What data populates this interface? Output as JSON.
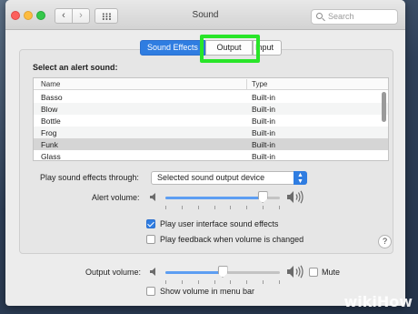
{
  "window": {
    "title": "Sound"
  },
  "search": {
    "placeholder": "Search"
  },
  "tabs": [
    {
      "label": "Sound Effects",
      "selected": true
    },
    {
      "label": "Output",
      "selected": false,
      "highlighted": true
    },
    {
      "label": "Input",
      "selected": false
    }
  ],
  "alert_section": {
    "heading": "Select an alert sound:",
    "columns": [
      "Name",
      "Type"
    ],
    "rows": [
      {
        "name": "Basso",
        "type": "Built-in"
      },
      {
        "name": "Blow",
        "type": "Built-in"
      },
      {
        "name": "Bottle",
        "type": "Built-in"
      },
      {
        "name": "Frog",
        "type": "Built-in"
      },
      {
        "name": "Funk",
        "type": "Built-in",
        "selected": true
      },
      {
        "name": "Glass",
        "type": "Built-in"
      }
    ]
  },
  "play_through": {
    "label": "Play sound effects through:",
    "selected": "Selected sound output device"
  },
  "alert_volume": {
    "label": "Alert volume:",
    "level": 0.85
  },
  "options": {
    "ui_sounds": {
      "label": "Play user interface sound effects",
      "checked": true
    },
    "feedback": {
      "label": "Play feedback when volume is changed",
      "checked": false
    }
  },
  "help": {
    "label": "?"
  },
  "output_volume": {
    "label": "Output volume:",
    "level": 0.5
  },
  "mute": {
    "label": "Mute",
    "checked": false
  },
  "menu_bar": {
    "label": "Show volume in menu bar",
    "checked": false
  },
  "watermark": {
    "wiki": "wiki",
    "how": "How"
  },
  "icons": [
    "back-chevron-icon",
    "forward-chevron-icon",
    "grid-icon",
    "search-icon",
    "speaker-low-icon",
    "speaker-high-icon",
    "popup-arrows-icon",
    "checkmark-icon"
  ],
  "colors": {
    "accent": "#2f7de1",
    "highlight": "#29e529",
    "selected_row": "#d5d5d5"
  }
}
